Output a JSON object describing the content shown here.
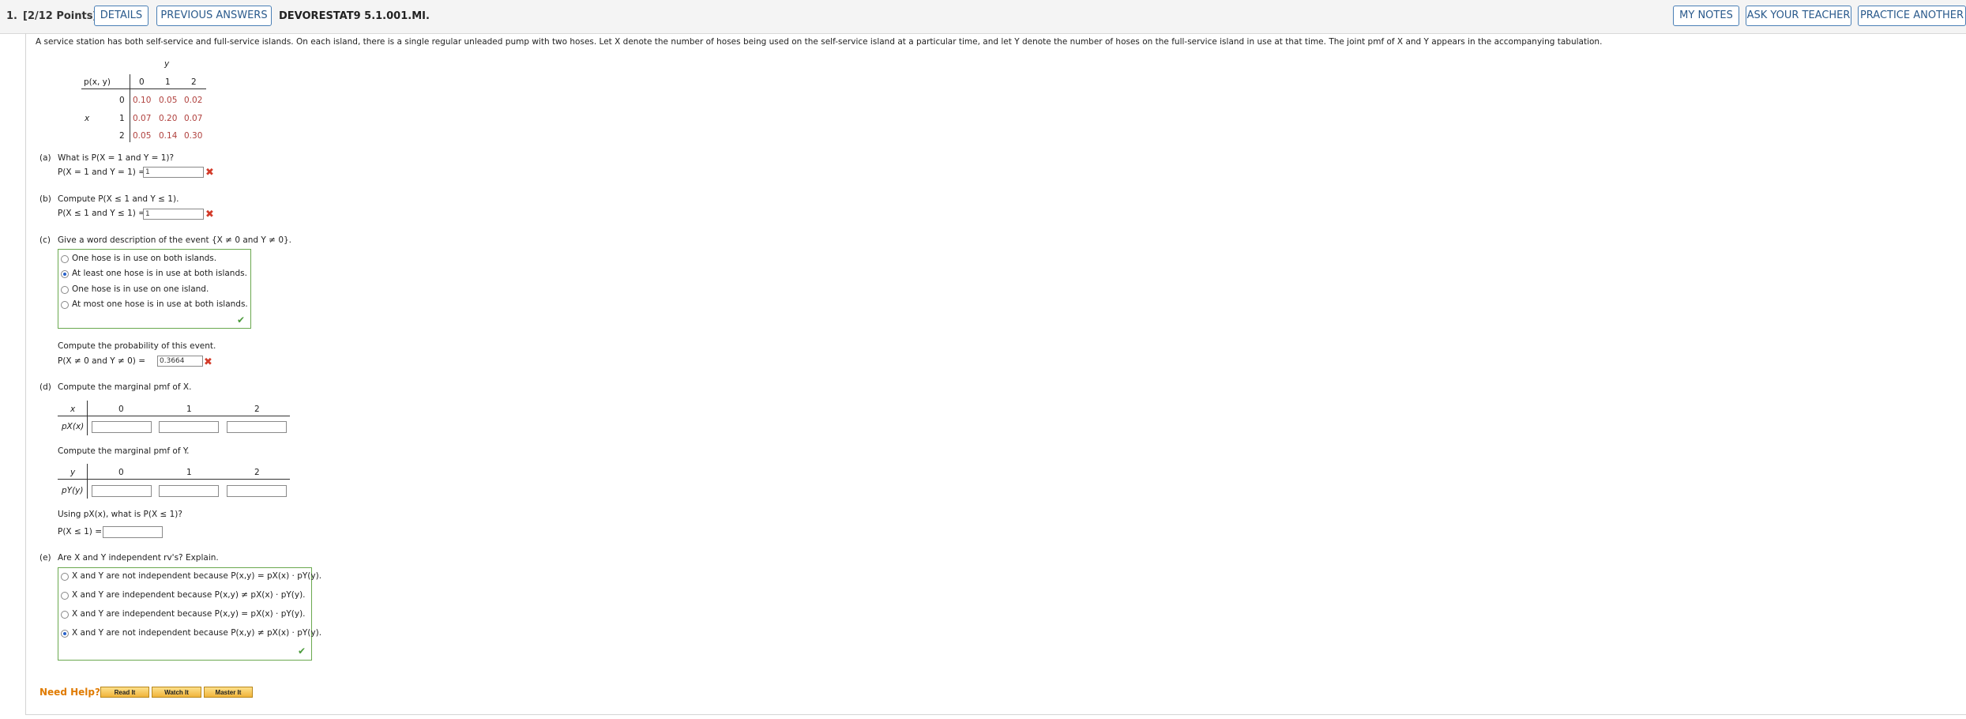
{
  "header": {
    "question_number": "1.",
    "points": "[2/12 Points]",
    "details_label": "DETAILS",
    "previous_answers_label": "PREVIOUS ANSWERS",
    "assignment_code": "DEVORESTAT9 5.1.001.MI.",
    "my_notes_label": "MY NOTES",
    "ask_teacher_label": "ASK YOUR TEACHER",
    "practice_another_label": "PRACTICE ANOTHER"
  },
  "problem": {
    "statement": "A service station has both self-service and full-service islands. On each island, there is a single regular unleaded pump with two hoses. Let X denote the number of hoses being used on the self-service island at a particular time, and let Y denote the number of hoses on the full-service island in use at that time. The joint pmf of X and Y appears in the accompanying tabulation."
  },
  "joint_table": {
    "y_label": "y",
    "x_label": "x",
    "corner_label": "p(x, y)",
    "col_headers": [
      "0",
      "1",
      "2"
    ],
    "row_headers": [
      "0",
      "1",
      "2"
    ],
    "rows": [
      [
        "0.10",
        "0.05",
        "0.02"
      ],
      [
        "0.07",
        "0.20",
        "0.07"
      ],
      [
        "0.05",
        "0.14",
        "0.30"
      ]
    ]
  },
  "part_a": {
    "label": "(a)",
    "question": "What is P(X = 1 and Y = 1)?",
    "prompt": "P(X = 1 and Y = 1) =",
    "answer": "1"
  },
  "part_b": {
    "label": "(b)",
    "question": "Compute P(X ≤ 1 and Y ≤ 1).",
    "prompt": "P(X ≤ 1 and Y ≤ 1) =",
    "answer": "1"
  },
  "part_c": {
    "label": "(c)",
    "question": "Give a word description of the event {X ≠ 0 and Y ≠ 0}.",
    "options": [
      "One hose is in use on both islands.",
      "At least one hose is in use at both islands.",
      "One hose is in use on one island.",
      "At most one hose is in use at both islands."
    ],
    "selected_index": 1,
    "compute_text": "Compute the probability of this event.",
    "prompt": "P(X ≠ 0 and Y ≠ 0) =",
    "answer": "0.3664"
  },
  "part_d": {
    "label": "(d)",
    "question": "Compute the marginal pmf of X.",
    "x_header": "x",
    "x_row_label": "pX(x)",
    "cols": [
      "0",
      "1",
      "2"
    ],
    "y_question": "Compute the marginal pmf of Y.",
    "y_header": "y",
    "y_row_label": "pY(y)",
    "using_text": "Using pX(x), what is P(X ≤ 1)?",
    "final_prompt": "P(X ≤ 1) ="
  },
  "part_e": {
    "label": "(e)",
    "question": "Are X and Y independent rv's? Explain.",
    "options": [
      "X and Y are not independent because P(x,y) = pX(x) · pY(y).",
      "X and Y are independent because P(x,y) ≠ pX(x) · pY(y).",
      "X and Y are independent because P(x,y) = pX(x) · pY(y).",
      "X and Y are not independent because P(x,y) ≠ pX(x) · pY(y)."
    ],
    "selected_index": 3
  },
  "help": {
    "label": "Need Help?",
    "read_it": "Read It",
    "watch_it": "Watch It",
    "master_it": "Master It"
  },
  "colors": {
    "button_border": "#4a7fb5",
    "table_values": "#b0413e",
    "incorrect": "#d33b2a",
    "correct": "#4a9a3a",
    "help_label": "#e07b00"
  }
}
